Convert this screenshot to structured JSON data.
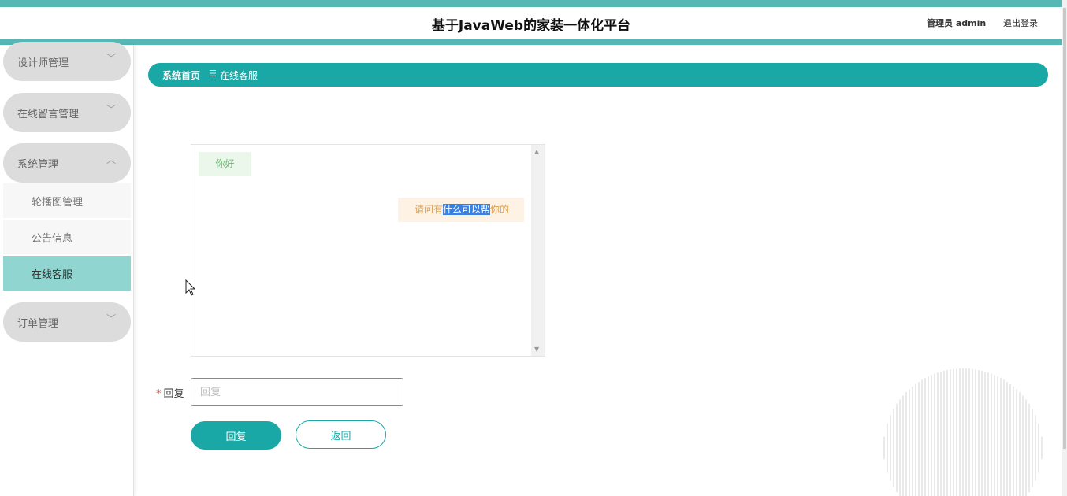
{
  "header": {
    "title": "基于JavaWeb的家装一体化平台",
    "user": "管理员 admin",
    "logout": "退出登录"
  },
  "sidebar": {
    "groups": [
      {
        "label": "设计师管理",
        "chevron": "﹀"
      },
      {
        "label": "在线留言管理",
        "chevron": "﹀"
      },
      {
        "label": "系统管理",
        "chevron": "︿"
      },
      {
        "label": "订单管理",
        "chevron": "﹀"
      }
    ],
    "sub_items": [
      {
        "label": "轮播图管理"
      },
      {
        "label": "公告信息"
      },
      {
        "label": "在线客服",
        "active": true
      }
    ]
  },
  "breadcrumb": {
    "home": "系统首页",
    "separator": "☰",
    "current": "在线客服"
  },
  "chat": {
    "messages": [
      {
        "side": "left",
        "text": "你好"
      },
      {
        "side": "right",
        "text_before": "请问有",
        "text_selected": "什么可以帮",
        "text_after": "你的"
      }
    ]
  },
  "form": {
    "required_mark": "*",
    "label": "回复",
    "placeholder": "回复",
    "value": "",
    "submit": "回复",
    "back": "返回"
  },
  "colors": {
    "accent": "#1aa8a6",
    "header_stripe": "#56b7b4",
    "active_menu": "#91d5d1"
  },
  "icons": {
    "scroll_up": "triangle-up-icon",
    "scroll_down": "triangle-down-icon",
    "cursor": "mouse-pointer-icon"
  }
}
